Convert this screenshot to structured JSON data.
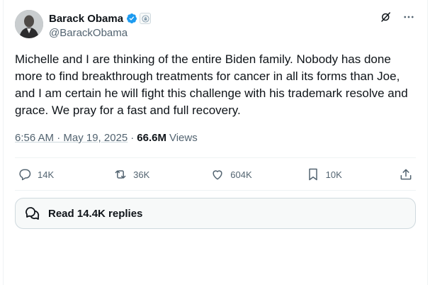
{
  "author": {
    "display_name": "Barack Obama",
    "handle": "@BarackObama",
    "verified": true
  },
  "tweet": {
    "text": "Michelle and I are thinking of the entire Biden family. Nobody has done more to find breakthrough treatments for cancer in all its forms than Joe, and I am certain he will fight this challenge with his trademark resolve and grace. We pray for a fast and full recovery.",
    "time": "6:56 AM · May 19, 2025",
    "separator": "·",
    "views_count": "66.6M",
    "views_label": "Views"
  },
  "actions": {
    "replies": "14K",
    "reposts": "36K",
    "likes": "604K",
    "bookmarks": "10K"
  },
  "read_replies": {
    "label": "Read 14.4K replies"
  },
  "colors": {
    "text": "#0f1419",
    "muted": "#536471",
    "verified": "#1d9bf0",
    "border": "#cfd9de"
  }
}
